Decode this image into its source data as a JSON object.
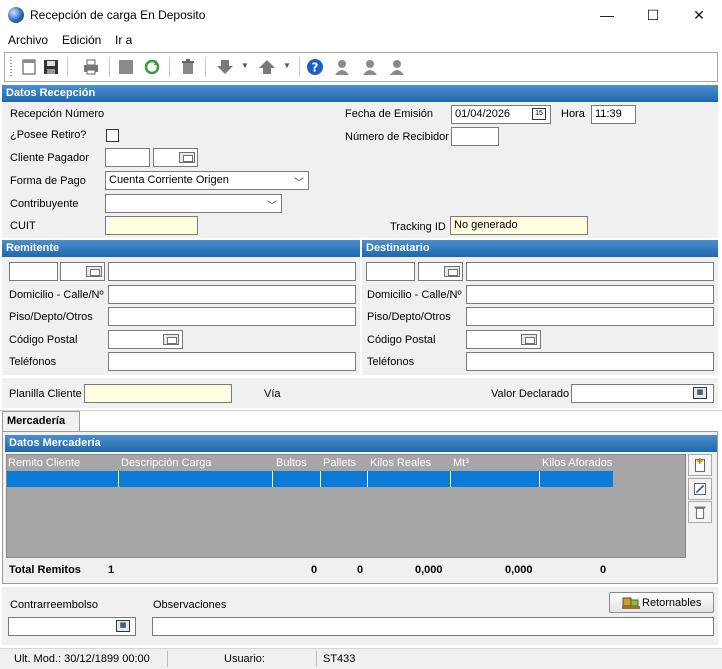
{
  "window": {
    "title": "Recepción de carga En Deposito",
    "minimize": "—",
    "maximize": "☐",
    "close": "✕"
  },
  "menu": [
    "Archivo",
    "Edición",
    "Ir a"
  ],
  "toolbar": {
    "icons": [
      "new-document-icon",
      "save-icon",
      "print-icon",
      "stop-icon",
      "refresh-icon",
      "delete-icon",
      "down-arrow-icon",
      "up-arrow-icon",
      "help-icon",
      "user-icon",
      "users-icon",
      "user-group-icon"
    ]
  },
  "datos_recepcion": {
    "header": "Datos Recepción",
    "recepcion_numero_label": "Recepción Número",
    "posee_retiro_label": "¿Posee Retiro?",
    "cliente_pagador_label": "Cliente Pagador",
    "forma_pago_label": "Forma de Pago",
    "forma_pago_value": "Cuenta Corriente Origen",
    "contribuyente_label": "Contribuyente",
    "contribuyente_value": "",
    "cuit_label": "CUIT",
    "cuit_value": "",
    "fecha_emision_label": "Fecha de Emisión",
    "fecha_emision_value": "01/04/2026",
    "hora_label": "Hora",
    "hora_value": "11:39",
    "numero_recibidor_label": "Número de Recibidor",
    "numero_recibidor_value": "",
    "tracking_label": "Tracking ID",
    "tracking_value": "No generado"
  },
  "remitente": {
    "header": "Remitente",
    "domicilio_label": "Domicilio - Calle/Nº",
    "piso_label": "Piso/Depto/Otros",
    "cp_label": "Código Postal",
    "telefonos_label": "Teléfonos"
  },
  "destinatario": {
    "header": "Destinatario",
    "domicilio_label": "Domicilio - Calle/Nº",
    "piso_label": "Piso/Depto/Otros",
    "cp_label": "Código Postal",
    "telefonos_label": "Teléfonos"
  },
  "planilla": {
    "planilla_label": "Planilla Cliente",
    "planilla_value": "",
    "via_label": "Vía",
    "valor_label": "Valor Declarado",
    "valor_value": ""
  },
  "mercaderia": {
    "tab": "Mercadería",
    "header": "Datos Mercadería",
    "columns": [
      "Remito Cliente",
      "Descripción Carga",
      "Bultos",
      "Pallets",
      "Kilos Reales",
      "Mt³",
      "Kilos Aforados"
    ],
    "totals": {
      "label": "Total Remitos",
      "remitos": "1",
      "bultos": "0",
      "pallets": "0",
      "kilos_reales": "0,000",
      "mt3": "0,000",
      "kilos_aforados": "0"
    }
  },
  "footer": {
    "contrarreembolso_label": "Contrarreembolso",
    "contrarreembolso_value": "",
    "observaciones_label": "Observaciones",
    "observaciones_value": "",
    "retornables_label": "Retornables"
  },
  "status": {
    "ult_mod": "Ult. Mod.: 30/12/1899 00:00",
    "usuario_label": "Usuario:",
    "usuario_value": "ST433"
  },
  "colors": {
    "section_header": "#2a73b8",
    "selected_row": "#0a7bd6",
    "required_field": "#ffffe1"
  }
}
